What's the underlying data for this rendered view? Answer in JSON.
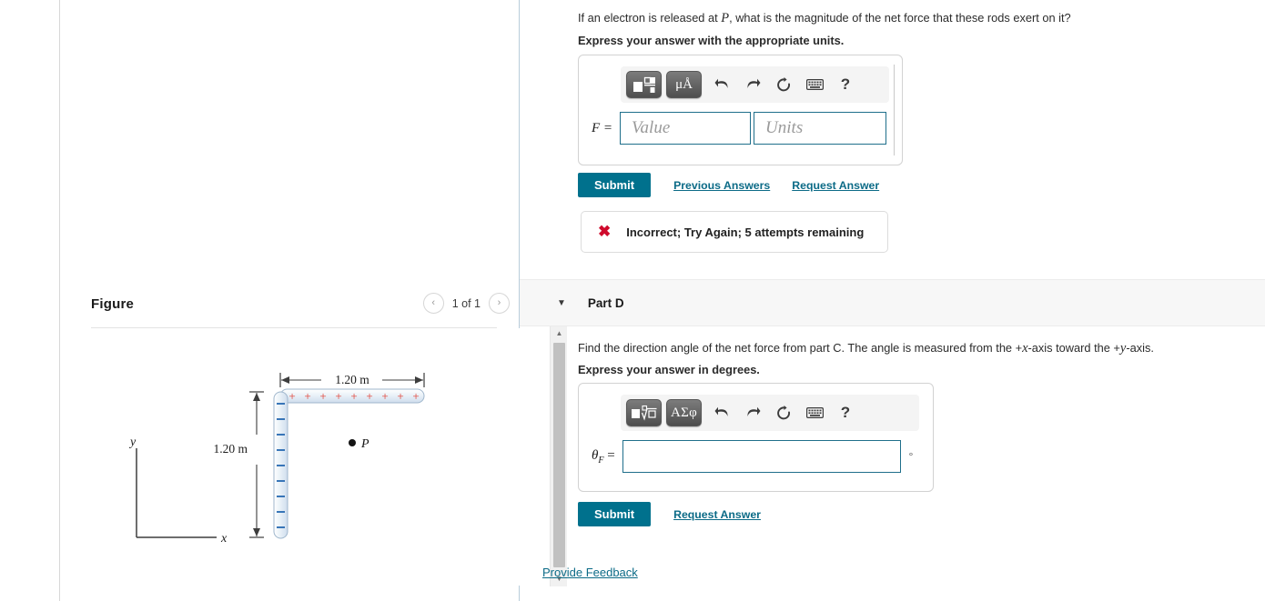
{
  "part_c": {
    "prompt_pre": "If an electron is released at ",
    "prompt_var": "P",
    "prompt_post": ", what is the magnitude of the net force that these rods exert on it?",
    "express": "Express your answer with the appropriate units.",
    "field_label": "F =",
    "value_placeholder": "Value",
    "units_placeholder": "Units",
    "value_text": "",
    "units_text": "",
    "toolbar": {
      "template_button": "template-fraction",
      "units_button": "μÅ",
      "undo": "↶",
      "redo": "↷",
      "reset": "↺",
      "keyboard": "keyboard",
      "help": "?"
    },
    "submit_label": "Submit",
    "previous_answers_label": "Previous Answers",
    "request_answer_label": "Request Answer",
    "feedback": {
      "icon": "x-mark",
      "text": "Incorrect; Try Again; 5 attempts remaining"
    }
  },
  "part_d": {
    "header_label": "Part D",
    "caret": "▼",
    "prompt_pre": "Find the direction angle of the net force from part C. The angle is measured from the +",
    "prompt_var1": "x",
    "prompt_mid": "-axis toward the +",
    "prompt_var2": "y",
    "prompt_post": "-axis.",
    "express": "Express your answer in degrees.",
    "field_label_theta": "θ",
    "field_label_sub": "F",
    "field_label_eq": " =",
    "theta_value": "",
    "degree_symbol": "°",
    "toolbar": {
      "template_button": "template-radical",
      "greek_button": "ΑΣφ",
      "undo": "↶",
      "redo": "↷",
      "reset": "↺",
      "keyboard": "keyboard",
      "help": "?"
    },
    "submit_label": "Submit",
    "request_answer_label": "Request Answer"
  },
  "figure": {
    "title": "Figure",
    "prev_icon": "‹",
    "next_icon": "›",
    "counter": "1 of 1",
    "scrollbar": {
      "up": "▲",
      "down": "▼"
    },
    "diagram": {
      "horizontal_rod": {
        "label": "1.20 m",
        "charge_symbol": "+",
        "charge_count": 9,
        "charge_color": "#e23a2e"
      },
      "vertical_rod": {
        "label": "1.20 m",
        "charge_symbol": "−",
        "charge_count": 9,
        "charge_color": "#2f6fb5"
      },
      "point_label": "P",
      "axis_x_label": "x",
      "axis_y_label": "y"
    }
  },
  "footer": {
    "provide_feedback_label": "Provide Feedback"
  },
  "colors": {
    "accent": "#00718d",
    "link": "#0c6b87",
    "error": "#cf0a2c",
    "input_border": "#1f6f8b",
    "positive_charge": "#e23a2e",
    "negative_charge": "#2f6fb5"
  }
}
